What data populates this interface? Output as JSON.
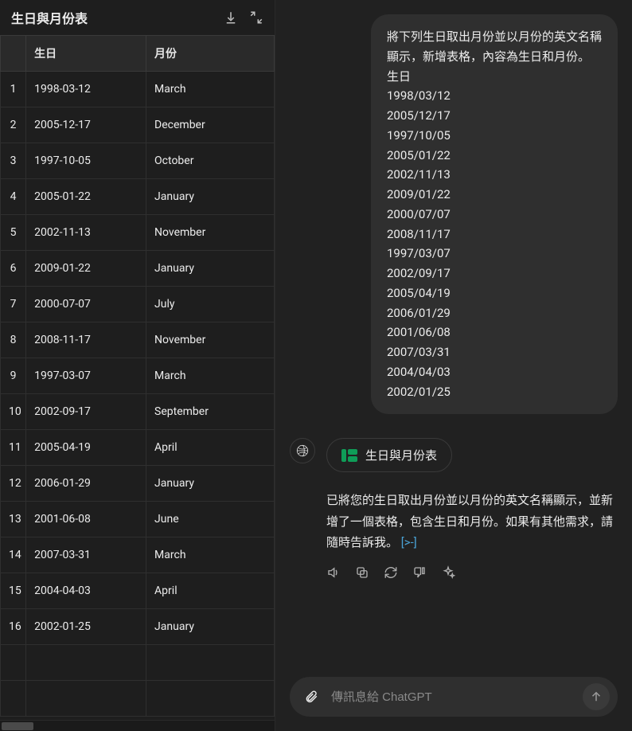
{
  "panel": {
    "title": "生日與月份表",
    "columns": [
      "生日",
      "月份"
    ],
    "rows": [
      {
        "n": "1",
        "birthday": "1998-03-12",
        "month": "March"
      },
      {
        "n": "2",
        "birthday": "2005-12-17",
        "month": "December"
      },
      {
        "n": "3",
        "birthday": "1997-10-05",
        "month": "October"
      },
      {
        "n": "4",
        "birthday": "2005-01-22",
        "month": "January"
      },
      {
        "n": "5",
        "birthday": "2002-11-13",
        "month": "November"
      },
      {
        "n": "6",
        "birthday": "2009-01-22",
        "month": "January"
      },
      {
        "n": "7",
        "birthday": "2000-07-07",
        "month": "July"
      },
      {
        "n": "8",
        "birthday": "2008-11-17",
        "month": "November"
      },
      {
        "n": "9",
        "birthday": "1997-03-07",
        "month": "March"
      },
      {
        "n": "10",
        "birthday": "2002-09-17",
        "month": "September"
      },
      {
        "n": "11",
        "birthday": "2005-04-19",
        "month": "April"
      },
      {
        "n": "12",
        "birthday": "2006-01-29",
        "month": "January"
      },
      {
        "n": "13",
        "birthday": "2001-06-08",
        "month": "June"
      },
      {
        "n": "14",
        "birthday": "2007-03-31",
        "month": "March"
      },
      {
        "n": "15",
        "birthday": "2004-04-03",
        "month": "April"
      },
      {
        "n": "16",
        "birthday": "2002-01-25",
        "month": "January"
      }
    ]
  },
  "chat": {
    "user_message": {
      "intro": "將下列生日取出月份並以月份的英文名稱顯示，新增表格，內容為生日和月份。",
      "label": "生日",
      "dates": [
        "1998/03/12",
        "2005/12/17",
        "1997/10/05",
        "2005/01/22",
        "2002/11/13",
        "2009/01/22",
        "2000/07/07",
        "2008/11/17",
        "1997/03/07",
        "2002/09/17",
        "2005/04/19",
        "2006/01/29",
        "2001/06/08",
        "2007/03/31",
        "2004/04/03",
        "2002/01/25"
      ]
    },
    "assistant": {
      "chip_label": "生日與月份表",
      "text": "已將您的生日取出月份並以月份的英文名稱顯示，並新增了一個表格，包含生日和月份。如果有其他需求，請隨時告訴我。",
      "link": "[>-]"
    }
  },
  "composer": {
    "placeholder": "傳訊息給 ChatGPT"
  }
}
